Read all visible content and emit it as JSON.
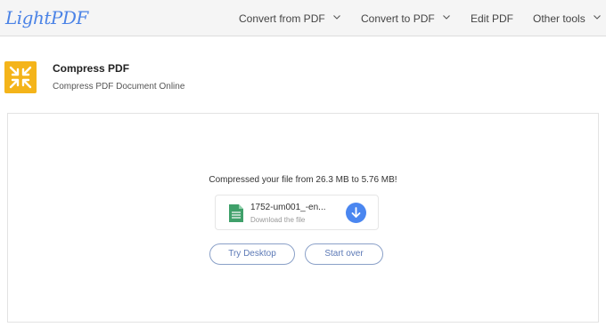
{
  "logo": {
    "text": "LightPDF"
  },
  "nav": {
    "items": [
      {
        "label": "Convert from PDF",
        "has_dropdown": true
      },
      {
        "label": "Convert to PDF",
        "has_dropdown": true
      },
      {
        "label": "Edit PDF",
        "has_dropdown": false
      },
      {
        "label": "Other tools",
        "has_dropdown": true
      }
    ]
  },
  "tool": {
    "icon": "compress-arrows-icon",
    "title": "Compress PDF",
    "subtitle": "Compress PDF Document Online"
  },
  "result": {
    "message": "Compressed your file from 26.3 MB to 5.76 MB!",
    "file": {
      "name": "1752-um001_-en...",
      "action_label": "Download the file",
      "icon": "document-icon"
    },
    "download_icon": "download-icon"
  },
  "buttons": {
    "try_desktop": "Try Desktop",
    "start_over": "Start over"
  },
  "colors": {
    "brand": "#4b83e6",
    "tool_icon_bg": "#f4b41a",
    "file_icon": "#3fa06a",
    "download_btn": "#4a86f0",
    "pill_border": "#8aa0c8",
    "pill_text": "#5c79b6"
  }
}
